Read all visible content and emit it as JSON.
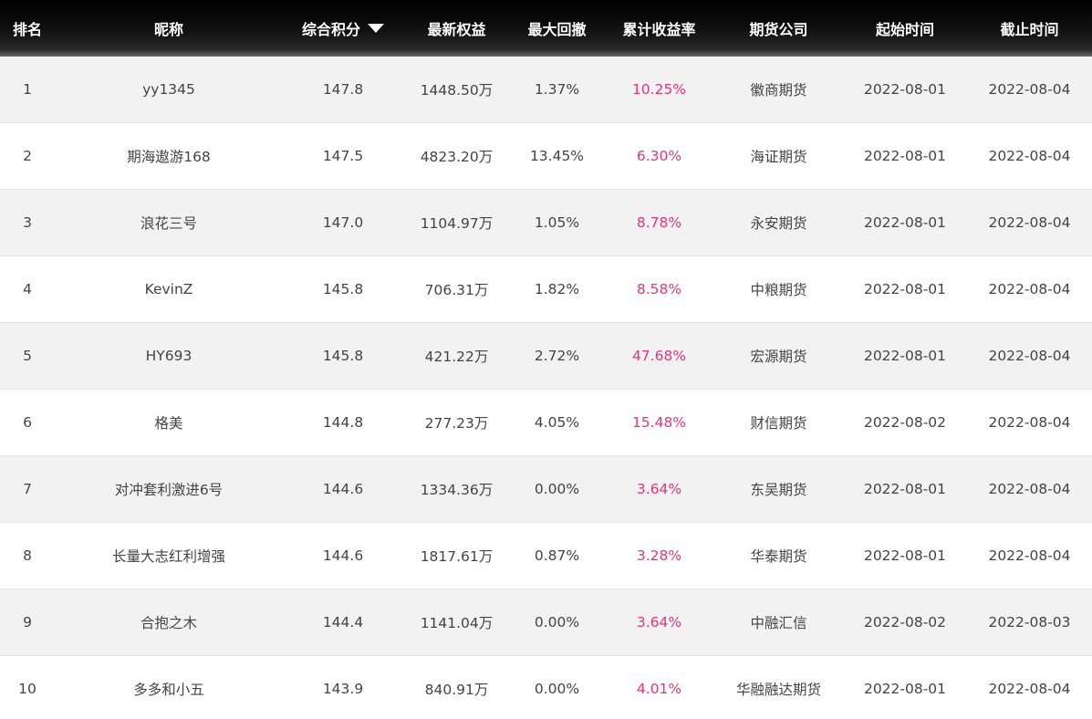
{
  "header": {
    "rank": "排名",
    "nickname": "昵称",
    "score": "综合积分",
    "equity": "最新权益",
    "max_drawdown": "最大回撤",
    "return_rate": "累计收益率",
    "company": "期货公司",
    "start_time": "起始时间",
    "end_time": "截止时间"
  },
  "rows": [
    {
      "rank": "1",
      "nickname": "yy1345",
      "score": "147.8",
      "equity": "1448.50万",
      "max_drawdown": "1.37%",
      "return_rate": "10.25%",
      "company": "徽商期货",
      "start_time": "2022-08-01",
      "end_time": "2022-08-04"
    },
    {
      "rank": "2",
      "nickname": "期海遨游168",
      "score": "147.5",
      "equity": "4823.20万",
      "max_drawdown": "13.45%",
      "return_rate": "6.30%",
      "company": "海证期货",
      "start_time": "2022-08-01",
      "end_time": "2022-08-04"
    },
    {
      "rank": "3",
      "nickname": "浪花三号",
      "score": "147.0",
      "equity": "1104.97万",
      "max_drawdown": "1.05%",
      "return_rate": "8.78%",
      "company": "永安期货",
      "start_time": "2022-08-01",
      "end_time": "2022-08-04"
    },
    {
      "rank": "4",
      "nickname": "KevinZ",
      "score": "145.8",
      "equity": "706.31万",
      "max_drawdown": "1.82%",
      "return_rate": "8.58%",
      "company": "中粮期货",
      "start_time": "2022-08-01",
      "end_time": "2022-08-04"
    },
    {
      "rank": "5",
      "nickname": "HY693",
      "score": "145.8",
      "equity": "421.22万",
      "max_drawdown": "2.72%",
      "return_rate": "47.68%",
      "company": "宏源期货",
      "start_time": "2022-08-01",
      "end_time": "2022-08-04"
    },
    {
      "rank": "6",
      "nickname": "格美",
      "score": "144.8",
      "equity": "277.23万",
      "max_drawdown": "4.05%",
      "return_rate": "15.48%",
      "company": "财信期货",
      "start_time": "2022-08-02",
      "end_time": "2022-08-04"
    },
    {
      "rank": "7",
      "nickname": "对冲套利激进6号",
      "score": "144.6",
      "equity": "1334.36万",
      "max_drawdown": "0.00%",
      "return_rate": "3.64%",
      "company": "东吴期货",
      "start_time": "2022-08-01",
      "end_time": "2022-08-04"
    },
    {
      "rank": "8",
      "nickname": "长量大志红利增强",
      "score": "144.6",
      "equity": "1817.61万",
      "max_drawdown": "0.87%",
      "return_rate": "3.28%",
      "company": "华泰期货",
      "start_time": "2022-08-01",
      "end_time": "2022-08-04"
    },
    {
      "rank": "9",
      "nickname": "合抱之木",
      "score": "144.4",
      "equity": "1141.04万",
      "max_drawdown": "0.00%",
      "return_rate": "3.64%",
      "company": "中融汇信",
      "start_time": "2022-08-02",
      "end_time": "2022-08-03"
    },
    {
      "rank": "10",
      "nickname": "多多和小五",
      "score": "143.9",
      "equity": "840.91万",
      "max_drawdown": "0.00%",
      "return_rate": "4.01%",
      "company": "华融融达期货",
      "start_time": "2022-08-01",
      "end_time": "2022-08-04"
    }
  ],
  "colors": {
    "header_bg": "#000000",
    "return_text": "#e8347a",
    "odd_row_bg": "#f2f2f2",
    "even_row_bg": "#ffffff"
  },
  "icons": {
    "sort": "triangle-down"
  }
}
